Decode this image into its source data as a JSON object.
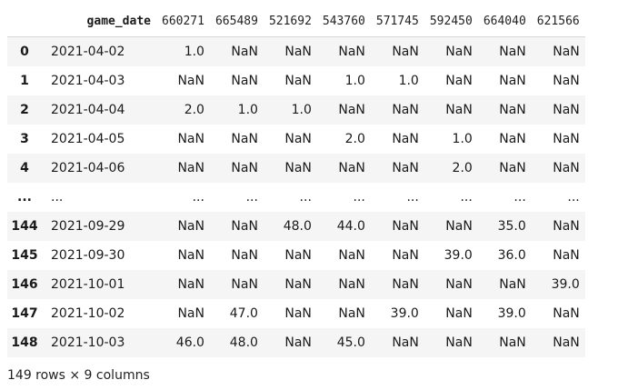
{
  "columns": [
    "",
    "game_date",
    "660271",
    "665489",
    "521692",
    "543760",
    "571745",
    "592450",
    "664040",
    "621566"
  ],
  "rows": [
    {
      "index": "0",
      "values": [
        "2021-04-02",
        "1.0",
        "NaN",
        "NaN",
        "NaN",
        "NaN",
        "NaN",
        "NaN",
        "NaN"
      ]
    },
    {
      "index": "1",
      "values": [
        "2021-04-03",
        "NaN",
        "NaN",
        "NaN",
        "1.0",
        "1.0",
        "NaN",
        "NaN",
        "NaN"
      ]
    },
    {
      "index": "2",
      "values": [
        "2021-04-04",
        "2.0",
        "1.0",
        "1.0",
        "NaN",
        "NaN",
        "NaN",
        "NaN",
        "NaN"
      ]
    },
    {
      "index": "3",
      "values": [
        "2021-04-05",
        "NaN",
        "NaN",
        "NaN",
        "2.0",
        "NaN",
        "1.0",
        "NaN",
        "NaN"
      ]
    },
    {
      "index": "4",
      "values": [
        "2021-04-06",
        "NaN",
        "NaN",
        "NaN",
        "NaN",
        "NaN",
        "2.0",
        "NaN",
        "NaN"
      ]
    },
    {
      "index": "...",
      "values": [
        "...",
        "...",
        "...",
        "...",
        "...",
        "...",
        "...",
        "...",
        "..."
      ]
    },
    {
      "index": "144",
      "values": [
        "2021-09-29",
        "NaN",
        "NaN",
        "48.0",
        "44.0",
        "NaN",
        "NaN",
        "35.0",
        "NaN"
      ]
    },
    {
      "index": "145",
      "values": [
        "2021-09-30",
        "NaN",
        "NaN",
        "NaN",
        "NaN",
        "NaN",
        "39.0",
        "36.0",
        "NaN"
      ]
    },
    {
      "index": "146",
      "values": [
        "2021-10-01",
        "NaN",
        "NaN",
        "NaN",
        "NaN",
        "NaN",
        "NaN",
        "NaN",
        "39.0"
      ]
    },
    {
      "index": "147",
      "values": [
        "2021-10-02",
        "NaN",
        "47.0",
        "NaN",
        "NaN",
        "39.0",
        "NaN",
        "39.0",
        "NaN"
      ]
    },
    {
      "index": "148",
      "values": [
        "2021-10-03",
        "46.0",
        "48.0",
        "NaN",
        "45.0",
        "NaN",
        "NaN",
        "NaN",
        "NaN"
      ]
    }
  ],
  "footer": "149 rows × 9 columns"
}
